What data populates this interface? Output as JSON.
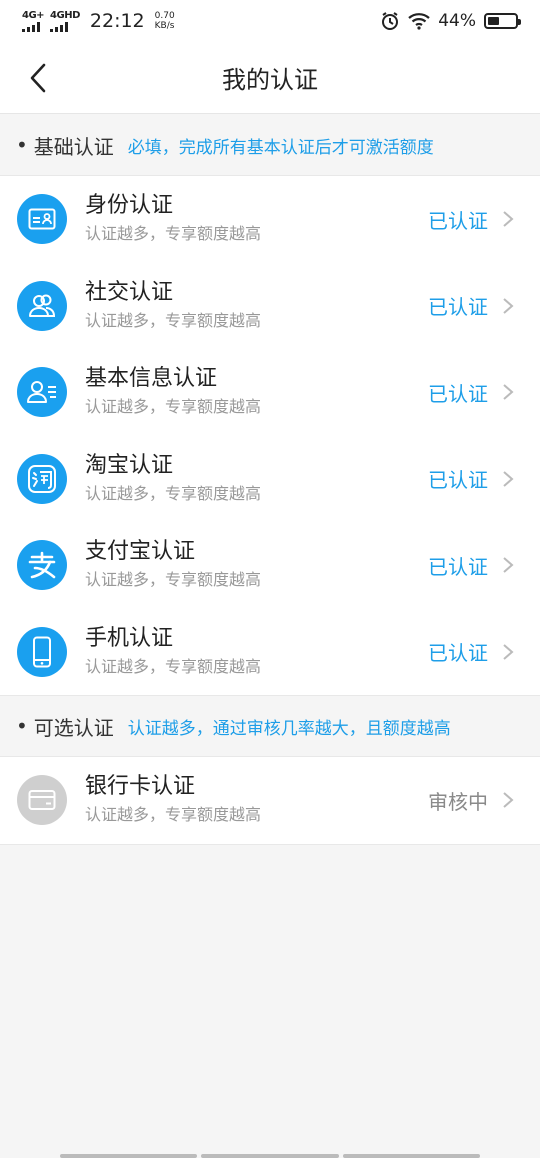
{
  "status_bar": {
    "net1": "4G+",
    "net2": "4GHD",
    "time": "22:12",
    "speed_value": "0.70",
    "speed_unit": "KB/s",
    "battery": "44%",
    "battery_level": 0.44
  },
  "nav": {
    "title": "我的认证"
  },
  "basic": {
    "title": "基础认证",
    "desc": "必填，完成所有基本认证后才可激活额度",
    "items": [
      {
        "title": "身份认证",
        "sub": "认证越多，专享额度越高",
        "status": "已认证",
        "icon": "id-card-icon"
      },
      {
        "title": "社交认证",
        "sub": "认证越多，专享额度越高",
        "status": "已认证",
        "icon": "contacts-icon"
      },
      {
        "title": "基本信息认证",
        "sub": "认证越多，专享额度越高",
        "status": "已认证",
        "icon": "user-info-icon"
      },
      {
        "title": "淘宝认证",
        "sub": "认证越多，专享额度越高",
        "status": "已认证",
        "icon": "taobao-icon"
      },
      {
        "title": "支付宝认证",
        "sub": "认证越多，专享额度越高",
        "status": "已认证",
        "icon": "alipay-icon"
      },
      {
        "title": "手机认证",
        "sub": "认证越多，专享额度越高",
        "status": "已认证",
        "icon": "phone-icon"
      }
    ]
  },
  "optional": {
    "title": "可选认证",
    "desc": "认证越多，通过审核几率越大，且额度越高",
    "items": [
      {
        "title": "银行卡认证",
        "sub": "认证越多，专享额度越高",
        "status": "审核中",
        "icon": "bank-card-icon"
      }
    ]
  },
  "colors": {
    "accent": "#1e9ee8",
    "icon_bg": "#1aa0ef",
    "pending": "#8a8a8a"
  }
}
